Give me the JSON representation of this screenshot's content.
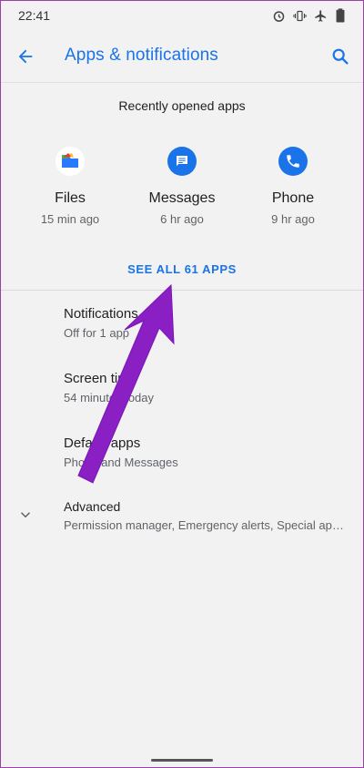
{
  "status_bar": {
    "time": "22:41",
    "icons": [
      "alarm-icon",
      "vibrate-icon",
      "airplane-mode-icon",
      "battery-icon"
    ]
  },
  "app_bar": {
    "back_icon": "arrow-back-icon",
    "title": "Apps & notifications",
    "search_icon": "search-icon"
  },
  "recent": {
    "header": "Recently opened apps",
    "apps": [
      {
        "name": "Files",
        "time": "15 min ago",
        "icon": "files-app-icon"
      },
      {
        "name": "Messages",
        "time": "6 hr ago",
        "icon": "messages-app-icon"
      },
      {
        "name": "Phone",
        "time": "9 hr ago",
        "icon": "phone-app-icon"
      }
    ],
    "see_all": "SEE ALL 61 APPS"
  },
  "settings": [
    {
      "title": "Notifications",
      "summary": "Off for 1 app"
    },
    {
      "title": "Screen time",
      "summary": "54 minutes today"
    },
    {
      "title": "Default apps",
      "summary": "Phone and Messages"
    },
    {
      "title": "Advanced",
      "summary": "Permission manager, Emergency alerts, Special app access"
    }
  ],
  "colors": {
    "accent": "#1a73e8",
    "annotation_arrow": "#8a1fc4",
    "background": "#f2f2f2"
  }
}
